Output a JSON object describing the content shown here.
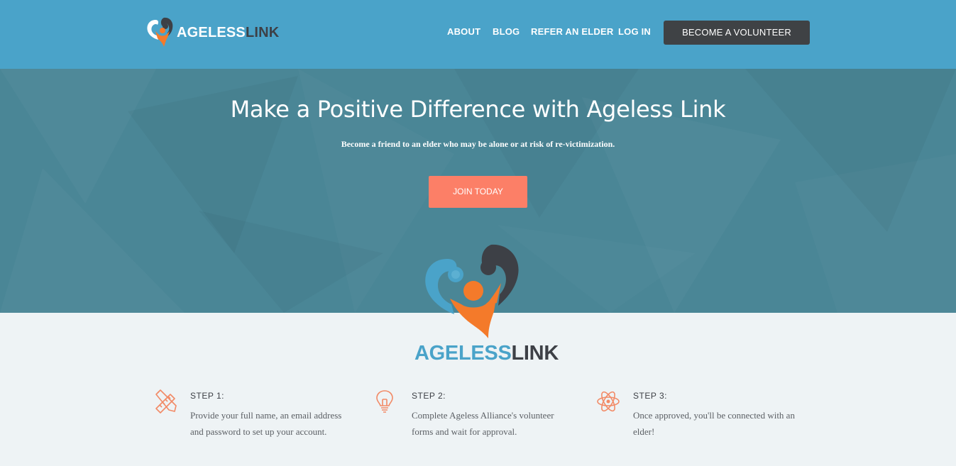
{
  "header": {
    "logo_text_ageless": "AGELESS",
    "logo_text_link": "LINK",
    "nav": {
      "about": "ABOUT",
      "blog": "BLOG",
      "refer": "REFER AN ELDER",
      "login": "LOG IN"
    },
    "cta": "BECOME A VOLUNTEER"
  },
  "hero": {
    "title": "Make a Positive Difference with Ageless Link",
    "subtitle": "Become a friend to an elder who may be alone or at risk of re-victimization.",
    "button": "JOIN TODAY"
  },
  "brand": {
    "ageless": "AGELESS",
    "link": "LINK"
  },
  "steps": [
    {
      "icon": "pencil-ruler-icon",
      "title": "STEP 1:",
      "text": "Provide your full name, an email address and password to set up your account."
    },
    {
      "icon": "lightbulb-icon",
      "title": "STEP 2:",
      "text": "Complete Ageless Alliance's volunteer forms and wait for approval."
    },
    {
      "icon": "atom-icon",
      "title": "STEP 3:",
      "text": "Once approved, you'll be connected with an elder!"
    }
  ],
  "colors": {
    "header_bg": "#4aa3c9",
    "hero_bg": "#4a8696",
    "accent_orange": "#fc7f67",
    "dark": "#3f4245",
    "page_bg": "#eef3f5",
    "brand_blue": "#4aa3c9",
    "brand_orange": "#f47a2a"
  }
}
